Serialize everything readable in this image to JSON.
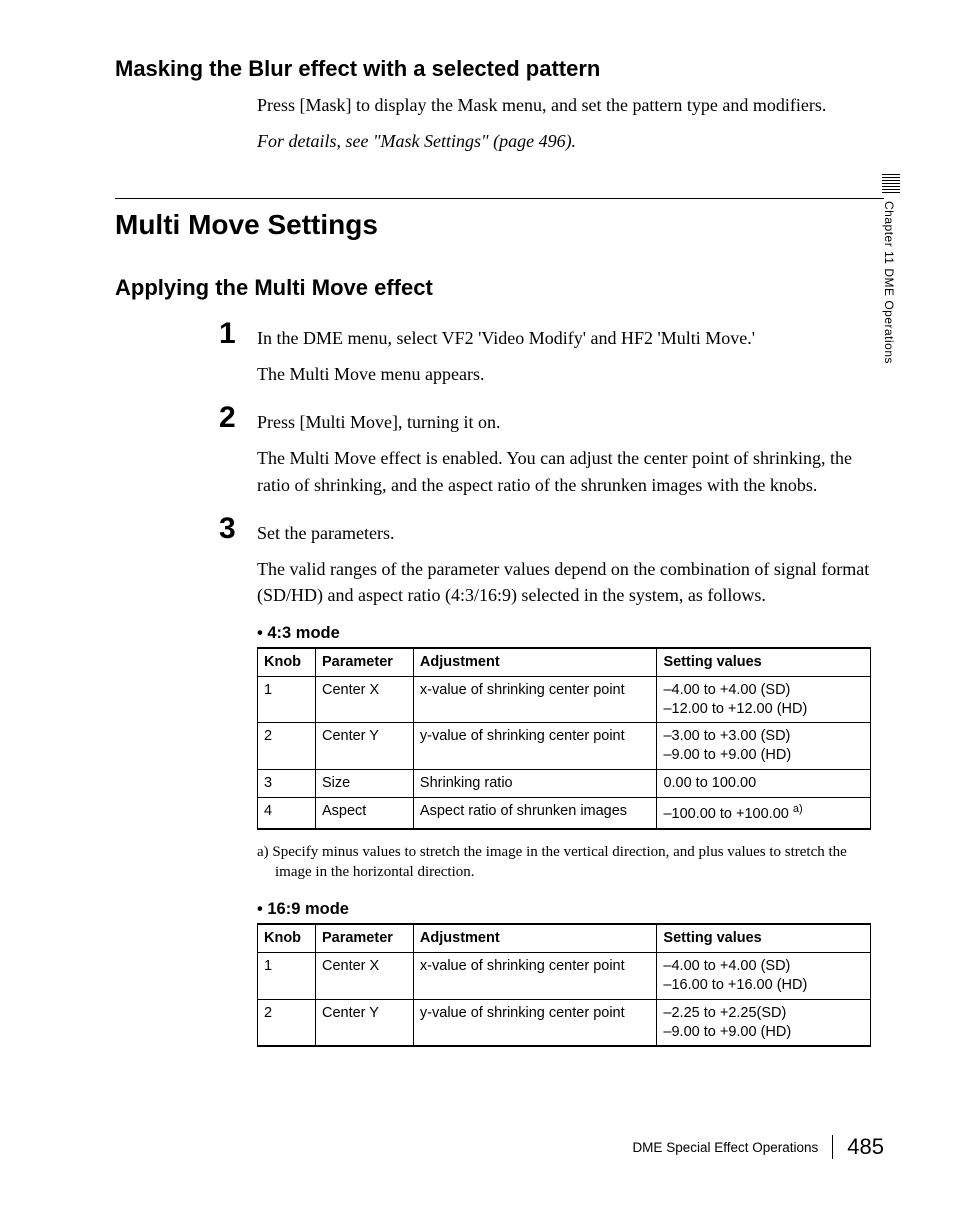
{
  "section1": {
    "heading": "Masking the Blur effect with a selected pattern",
    "para1": "Press [Mask] to display the Mask menu, and set the pattern type and modifiers.",
    "para2": "For details, see \"Mask Settings\" (page 496)."
  },
  "section2_heading": "Multi Move Settings",
  "section3": {
    "heading": "Applying the Multi Move effect",
    "steps": [
      {
        "num": "1",
        "text": "In the DME menu, select VF2 'Video Modify' and HF2 'Multi Move.'",
        "sub": "The Multi Move menu appears."
      },
      {
        "num": "2",
        "text": "Press [Multi Move], turning it on.",
        "sub": "The Multi Move effect is enabled. You can adjust the center point of shrinking, the ratio of shrinking, and the aspect ratio of the shrunken images with the knobs."
      },
      {
        "num": "3",
        "text": "Set the parameters.",
        "sub": "The valid ranges of the parameter values depend on the combination of signal format (SD/HD) and aspect ratio (4:3/16:9) selected in the system, as follows."
      }
    ]
  },
  "table_headers": {
    "knob": "Knob",
    "parameter": "Parameter",
    "adjustment": "Adjustment",
    "values": "Setting values"
  },
  "table43": {
    "title": "• 4:3 mode",
    "rows": [
      {
        "knob": "1",
        "param": "Center X",
        "adj": "x-value of shrinking center point",
        "val": "–4.00 to +4.00 (SD)\n–12.00 to +12.00 (HD)"
      },
      {
        "knob": "2",
        "param": "Center Y",
        "adj": "y-value of shrinking center point",
        "val": "–3.00 to +3.00 (SD)\n–9.00 to +9.00 (HD)"
      },
      {
        "knob": "3",
        "param": "Size",
        "adj": "Shrinking ratio",
        "val": "0.00 to 100.00"
      },
      {
        "knob": "4",
        "param": "Aspect",
        "adj": "Aspect ratio of shrunken images",
        "val": "–100.00 to +100.00",
        "sup": "a)"
      }
    ],
    "footnote": "a) Specify minus values to stretch the image in the vertical direction, and plus values to stretch the image in the horizontal direction."
  },
  "table169": {
    "title": "• 16:9 mode",
    "rows": [
      {
        "knob": "1",
        "param": "Center X",
        "adj": "x-value of shrinking center point",
        "val": "–4.00 to +4.00 (SD)\n–16.00 to +16.00 (HD)"
      },
      {
        "knob": "2",
        "param": "Center Y",
        "adj": "y-value of shrinking center point",
        "val": "–2.25 to +2.25(SD)\n–9.00 to +9.00 (HD)"
      }
    ]
  },
  "sidetab": "Chapter 11  DME Operations",
  "footer": {
    "text": "DME Special Effect Operations",
    "page": "485"
  }
}
